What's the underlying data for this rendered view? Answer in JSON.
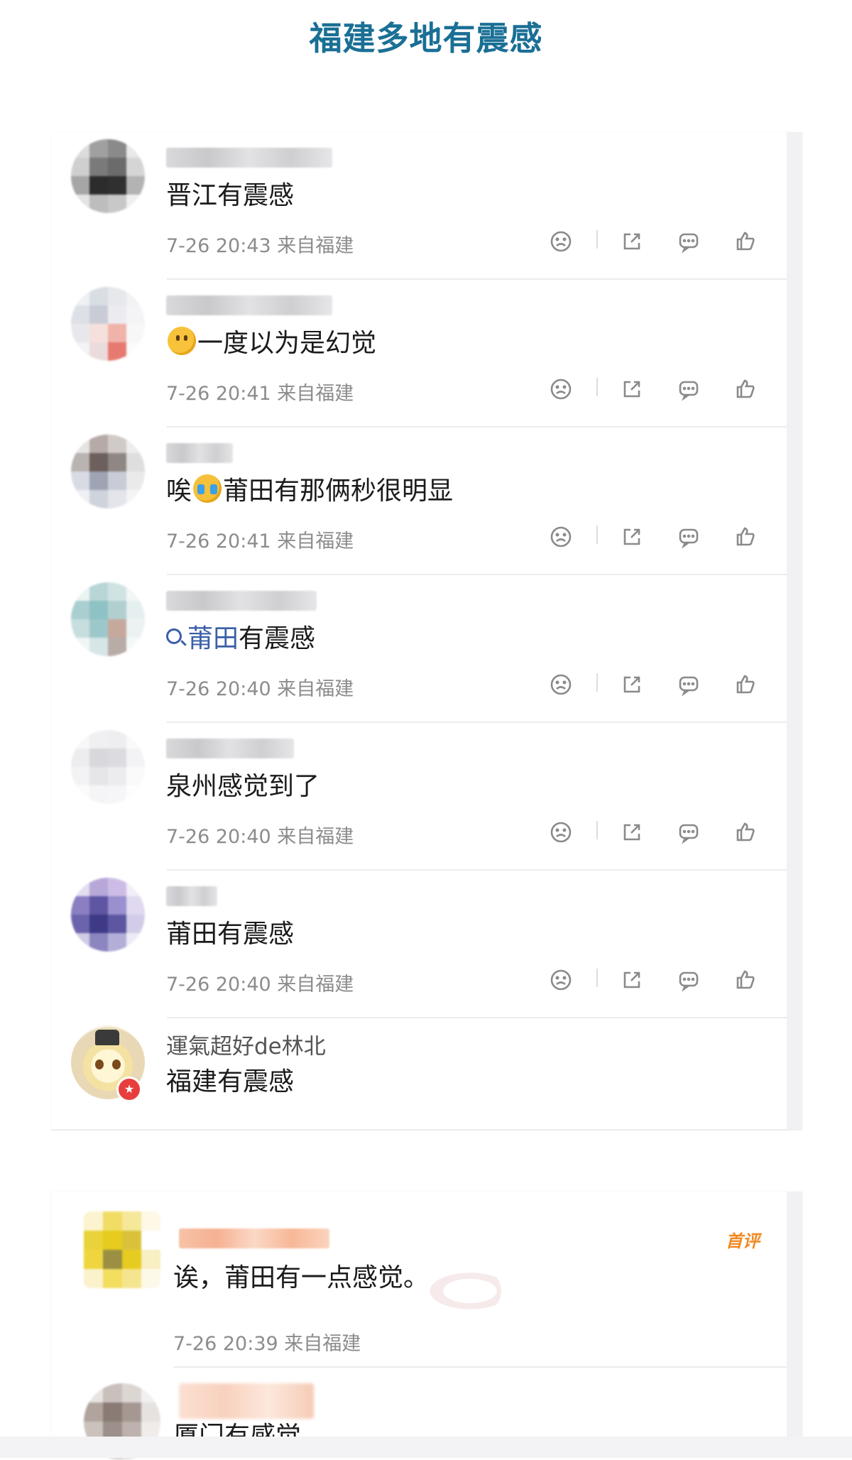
{
  "page_title": "福建多地有震感",
  "colors": {
    "title": "#1a6f95",
    "link": "#3b5ea7",
    "meta": "#8c8c8c",
    "badge_first": "#f08a24"
  },
  "action_icons": [
    "dislike-icon",
    "share-icon",
    "comment-icon",
    "like-icon"
  ],
  "comments": [
    {
      "text": "晋江有震感",
      "time": "7-26 20:43",
      "location": "来自福建"
    },
    {
      "text": "一度以为是幻觉",
      "time": "7-26 20:41",
      "location": "来自福建",
      "emoji": "smile-emoji"
    },
    {
      "pre": "唉",
      "text": "莆田有那俩秒很明显",
      "time": "7-26 20:41",
      "location": "来自福建",
      "emoji": "cry-laugh-emoji"
    },
    {
      "link": "莆田",
      "text": "有震感",
      "time": "7-26 20:40",
      "location": "来自福建"
    },
    {
      "text": "泉州感觉到了",
      "time": "7-26 20:40",
      "location": "来自福建"
    },
    {
      "text": "莆田有震感",
      "time": "7-26 20:40",
      "location": "来自福建"
    },
    {
      "name": "運氣超好de林北",
      "text": "福建有震感"
    }
  ],
  "second_card": {
    "badge": "首评",
    "text": "诶，莆田有一点感觉。",
    "time": "7-26 20:39",
    "location": "来自福建",
    "partial_text": "厦门有感觉"
  }
}
